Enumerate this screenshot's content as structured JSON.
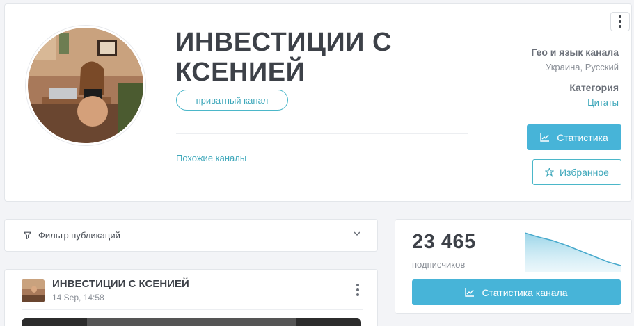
{
  "header": {
    "title": "ИНВЕСТИЦИИ С КСЕНИЕЙ",
    "badge": "приватный канал",
    "similar_link": "Похожие каналы",
    "geo_label": "Гео и язык канала",
    "geo_value": "Украина, Русский",
    "category_label": "Категория",
    "category_value": "Цитаты",
    "stats_button": "Статистика",
    "favorite_button": "Избранное"
  },
  "filter": {
    "label": "Фильтр публикаций"
  },
  "stats": {
    "subscribers": "23 465",
    "subscribers_label": "подписчиков",
    "button": "Статистика канала",
    "trend_color": "#8fd0e6"
  },
  "post": {
    "title": "ИНВЕСТИЦИИ С КСЕНИЕЙ",
    "time": "14 Sep, 14:58"
  },
  "colors": {
    "accent": "#47b4d8",
    "link": "#3da7ba"
  }
}
